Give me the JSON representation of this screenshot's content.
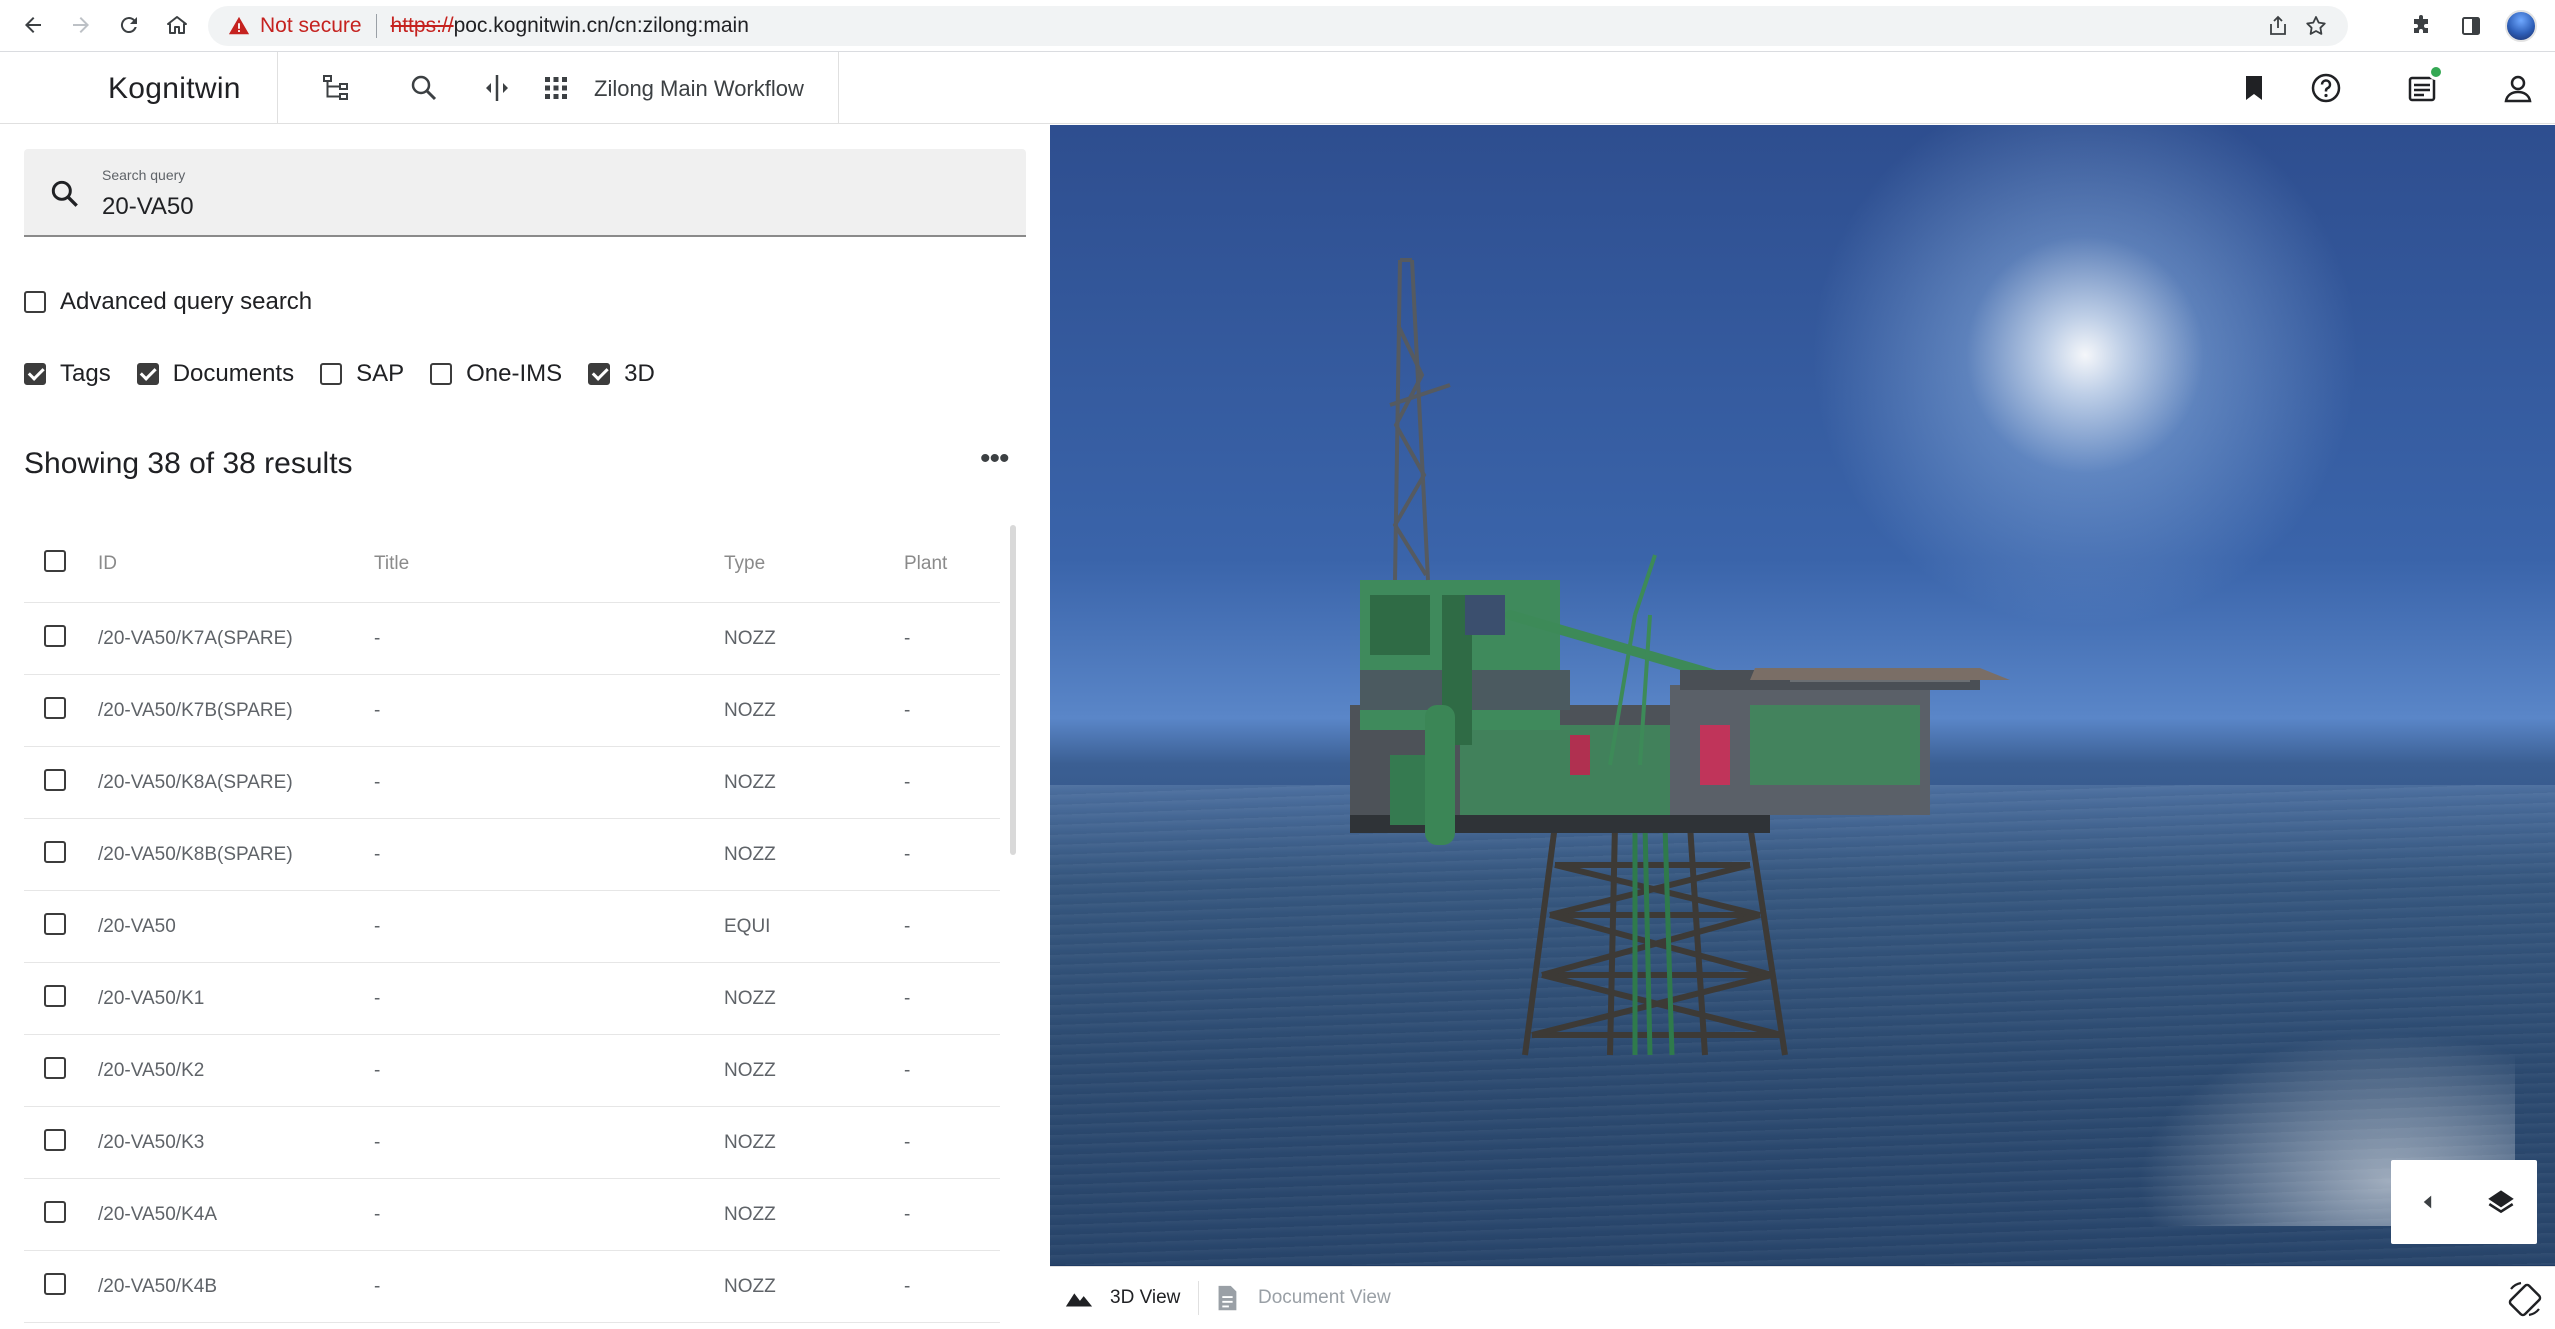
{
  "browser": {
    "security_text": "Not secure",
    "url_scheme": "https://",
    "url_rest": "poc.kognitwin.cn/cn:zilong:main"
  },
  "app": {
    "brand": "Kognitwin",
    "workflow": "Zilong Main Workflow"
  },
  "search": {
    "label": "Search query",
    "value": "20-VA50"
  },
  "advanced": {
    "label": "Advanced query search",
    "checked": false
  },
  "filters": [
    {
      "label": "Tags",
      "checked": true
    },
    {
      "label": "Documents",
      "checked": true
    },
    {
      "label": "SAP",
      "checked": false
    },
    {
      "label": "One-IMS",
      "checked": false
    },
    {
      "label": "3D",
      "checked": true
    }
  ],
  "results": {
    "summary": "Showing 38 of 38 results",
    "more": "•••"
  },
  "table": {
    "headers": {
      "id": "ID",
      "title": "Title",
      "type": "Type",
      "plant": "Plant"
    },
    "rows": [
      {
        "id": "/20-VA50/K7A(SPARE)",
        "title": "-",
        "type": "NOZZ",
        "plant": "-"
      },
      {
        "id": "/20-VA50/K7B(SPARE)",
        "title": "-",
        "type": "NOZZ",
        "plant": "-"
      },
      {
        "id": "/20-VA50/K8A(SPARE)",
        "title": "-",
        "type": "NOZZ",
        "plant": "-"
      },
      {
        "id": "/20-VA50/K8B(SPARE)",
        "title": "-",
        "type": "NOZZ",
        "plant": "-"
      },
      {
        "id": "/20-VA50",
        "title": "-",
        "type": "EQUI",
        "plant": "-"
      },
      {
        "id": "/20-VA50/K1",
        "title": "-",
        "type": "NOZZ",
        "plant": "-"
      },
      {
        "id": "/20-VA50/K2",
        "title": "-",
        "type": "NOZZ",
        "plant": "-"
      },
      {
        "id": "/20-VA50/K3",
        "title": "-",
        "type": "NOZZ",
        "plant": "-"
      },
      {
        "id": "/20-VA50/K4A",
        "title": "-",
        "type": "NOZZ",
        "plant": "-"
      },
      {
        "id": "/20-VA50/K4B",
        "title": "-",
        "type": "NOZZ",
        "plant": "-"
      }
    ]
  },
  "view_tabs": {
    "three_d": "3D View",
    "document": "Document View"
  },
  "colors": {
    "platform_green": "#3f8a5c",
    "platform_steel": "#3a3f45",
    "sea": "#2c4a70",
    "sky": "#3a64aa"
  }
}
